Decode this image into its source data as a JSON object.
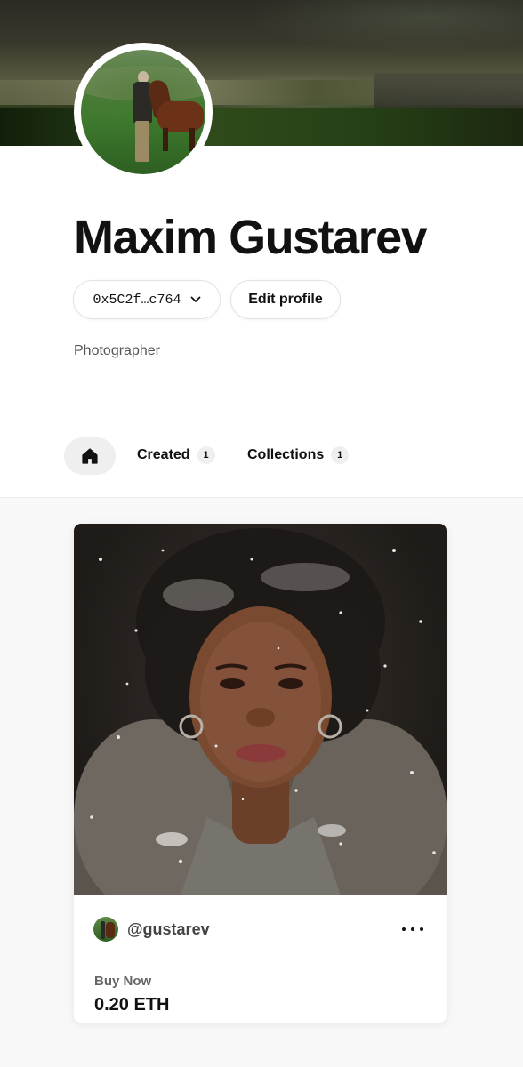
{
  "profile": {
    "name": "Maxim Gustarev",
    "wallet_address": "0x5C2f…c764",
    "edit_label": "Edit profile",
    "bio": "Photographer"
  },
  "tabs": [
    {
      "icon": "home-icon",
      "label": ""
    },
    {
      "label": "Created",
      "count": "1"
    },
    {
      "label": "Collections",
      "count": "1"
    }
  ],
  "nft_card": {
    "creator_handle": "@gustarev",
    "status_label": "Buy Now",
    "price": "0.20 ETH"
  },
  "colors": {
    "background": "#f8f8f8",
    "panel": "#ffffff",
    "text": "#111111",
    "muted": "#555555",
    "pill_bg": "#efefef"
  }
}
